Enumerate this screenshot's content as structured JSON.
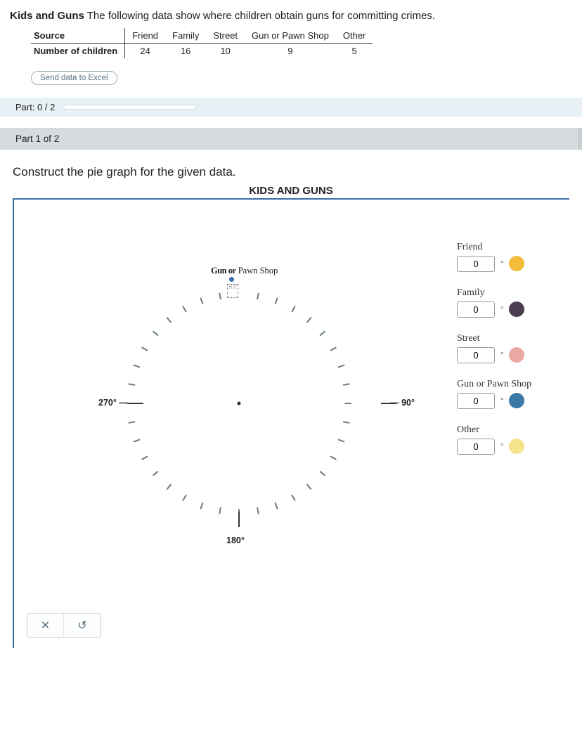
{
  "problem": {
    "title_bold": "Kids and Guns",
    "title_rest": " The following data show where children obtain guns for committing crimes."
  },
  "table": {
    "row1_label": "Source",
    "row2_label": "Number of children",
    "cols": [
      "Friend",
      "Family",
      "Street",
      "Gun or Pawn Shop",
      "Other"
    ],
    "values": [
      "24",
      "16",
      "10",
      "9",
      "5"
    ]
  },
  "buttons": {
    "send_excel": "Send data to Excel"
  },
  "progress": {
    "label": "Part: 0 / 2"
  },
  "part_header": "Part 1 of 2",
  "instruction": "Construct the pie graph for the given data.",
  "chart": {
    "title": "KIDS AND GUNS",
    "slice_overlap_text": "Gun or",
    "slice_pawn_text": " Pawn Shop",
    "axis_90": "90°",
    "axis_180": "180°",
    "axis_270": "270°"
  },
  "legend": {
    "items": [
      {
        "label": "Friend",
        "value": "0",
        "swatch": "sw-friend"
      },
      {
        "label": "Family",
        "value": "0",
        "swatch": "sw-family"
      },
      {
        "label": "Street",
        "value": "0",
        "swatch": "sw-street"
      },
      {
        "label": "Gun or Pawn Shop",
        "value": "0",
        "swatch": "sw-gun"
      },
      {
        "label": "Other",
        "value": "0",
        "swatch": "sw-other"
      }
    ],
    "degree_unit": "°"
  },
  "toolbar": {
    "clear": "✕",
    "undo": "↺"
  },
  "chart_data": {
    "type": "pie",
    "title": "KIDS AND GUNS",
    "categories": [
      "Friend",
      "Family",
      "Street",
      "Gun or Pawn Shop",
      "Other"
    ],
    "values": [
      24,
      16,
      10,
      9,
      5
    ],
    "current_angles_deg": [
      0,
      0,
      0,
      0,
      0
    ],
    "axis_markers_deg": [
      90,
      180,
      270
    ]
  }
}
